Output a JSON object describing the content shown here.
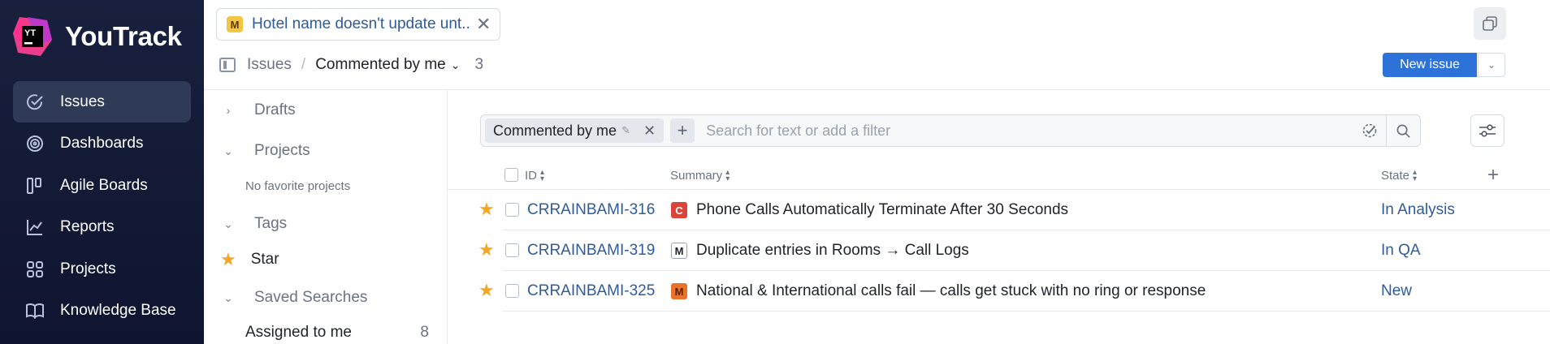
{
  "app": {
    "name": "YouTrack"
  },
  "sidebar": {
    "items": [
      {
        "label": "Issues",
        "icon": "check-circle-icon",
        "active": true
      },
      {
        "label": "Dashboards",
        "icon": "dashboard-icon",
        "active": false
      },
      {
        "label": "Agile Boards",
        "icon": "agile-board-icon",
        "active": false
      },
      {
        "label": "Reports",
        "icon": "chart-icon",
        "active": false
      },
      {
        "label": "Projects",
        "icon": "grid-icon",
        "active": false
      },
      {
        "label": "Knowledge Base",
        "icon": "book-icon",
        "active": false
      }
    ]
  },
  "tab": {
    "badge": "M",
    "title": "Hotel name doesn't update unt..."
  },
  "breadcrumb": {
    "root": "Issues",
    "current": "Commented by me",
    "count": "3"
  },
  "toolbar": {
    "new_issue_label": "New issue"
  },
  "left_panel": {
    "drafts": "Drafts",
    "projects": "Projects",
    "projects_empty": "No favorite projects",
    "tags": "Tags",
    "star_tag": "Star",
    "saved_searches": "Saved Searches",
    "assigned_label": "Assigned to me",
    "assigned_count": "8"
  },
  "search": {
    "chip_label": "Commented by me",
    "placeholder": "Search for text or add a filter"
  },
  "table": {
    "headers": {
      "id": "ID",
      "summary": "Summary",
      "state": "State"
    },
    "rows": [
      {
        "id": "CRRAINBAMI-316",
        "priority": "C",
        "priority_color": "#d9453a",
        "summary": "Phone Calls Automatically Terminate After 30 Seconds",
        "state": "In Analysis"
      },
      {
        "id": "CRRAINBAMI-319",
        "priority": "M",
        "priority_color": "#ffffff",
        "summary": "Duplicate entries in Rooms → Call Logs",
        "state": "In QA"
      },
      {
        "id": "CRRAINBAMI-325",
        "priority": "M",
        "priority_color": "#e8742b",
        "summary": "National & International calls fail — calls get stuck with no ring or response",
        "state": "New"
      }
    ]
  },
  "colors": {
    "accent": "#2d72d9",
    "star": "#f5a623",
    "link": "#2f5b9a",
    "nav_bg": "#18203d"
  }
}
